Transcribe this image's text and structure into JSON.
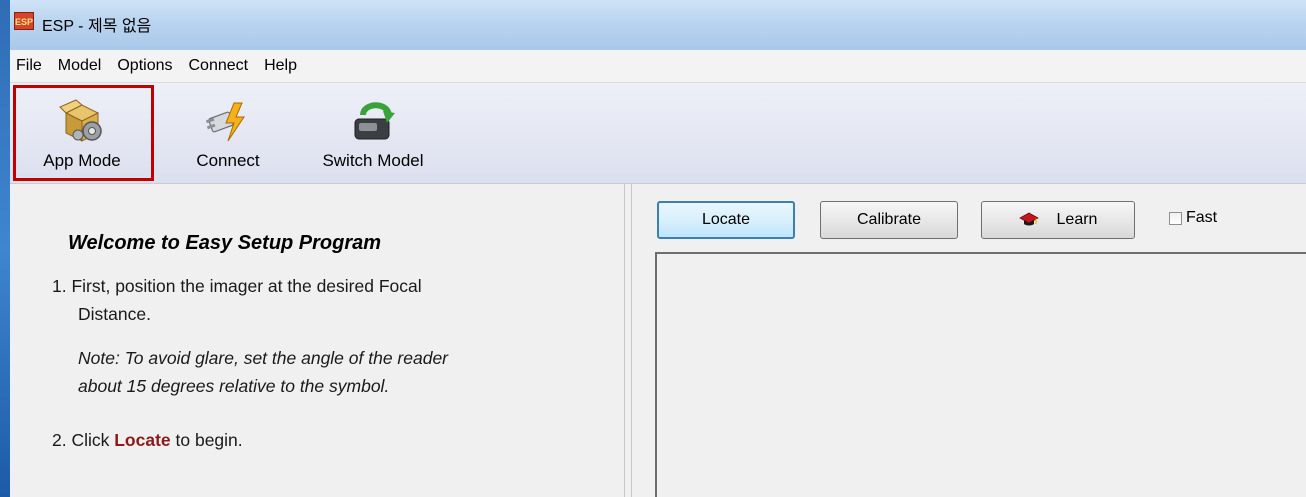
{
  "window": {
    "icon_text": "ESP",
    "title": "ESP - 제목 없음"
  },
  "menu": {
    "items": [
      "File",
      "Model",
      "Options",
      "Connect",
      "Help"
    ]
  },
  "toolbar": {
    "app_mode_label": "App Mode",
    "connect_label": "Connect",
    "switch_model_label": "Switch Model"
  },
  "instructions": {
    "heading": "Welcome to Easy Setup Program",
    "step1_line1": "1. First, position the imager at the desired Focal",
    "step1_line2": "Distance.",
    "note_line1": "Note: To avoid glare, set the angle of the reader",
    "note_line2": "about 15 degrees relative to the symbol.",
    "step2_prefix": "2. Click ",
    "step2_keyword": "Locate",
    "step2_suffix": " to begin."
  },
  "controls": {
    "locate_label": "Locate",
    "calibrate_label": "Calibrate",
    "learn_label": "Learn",
    "fast_label": "Fast",
    "fast_checked": false
  },
  "colors": {
    "highlight_border": "#c00000",
    "keyword": "#8b1a1a"
  }
}
